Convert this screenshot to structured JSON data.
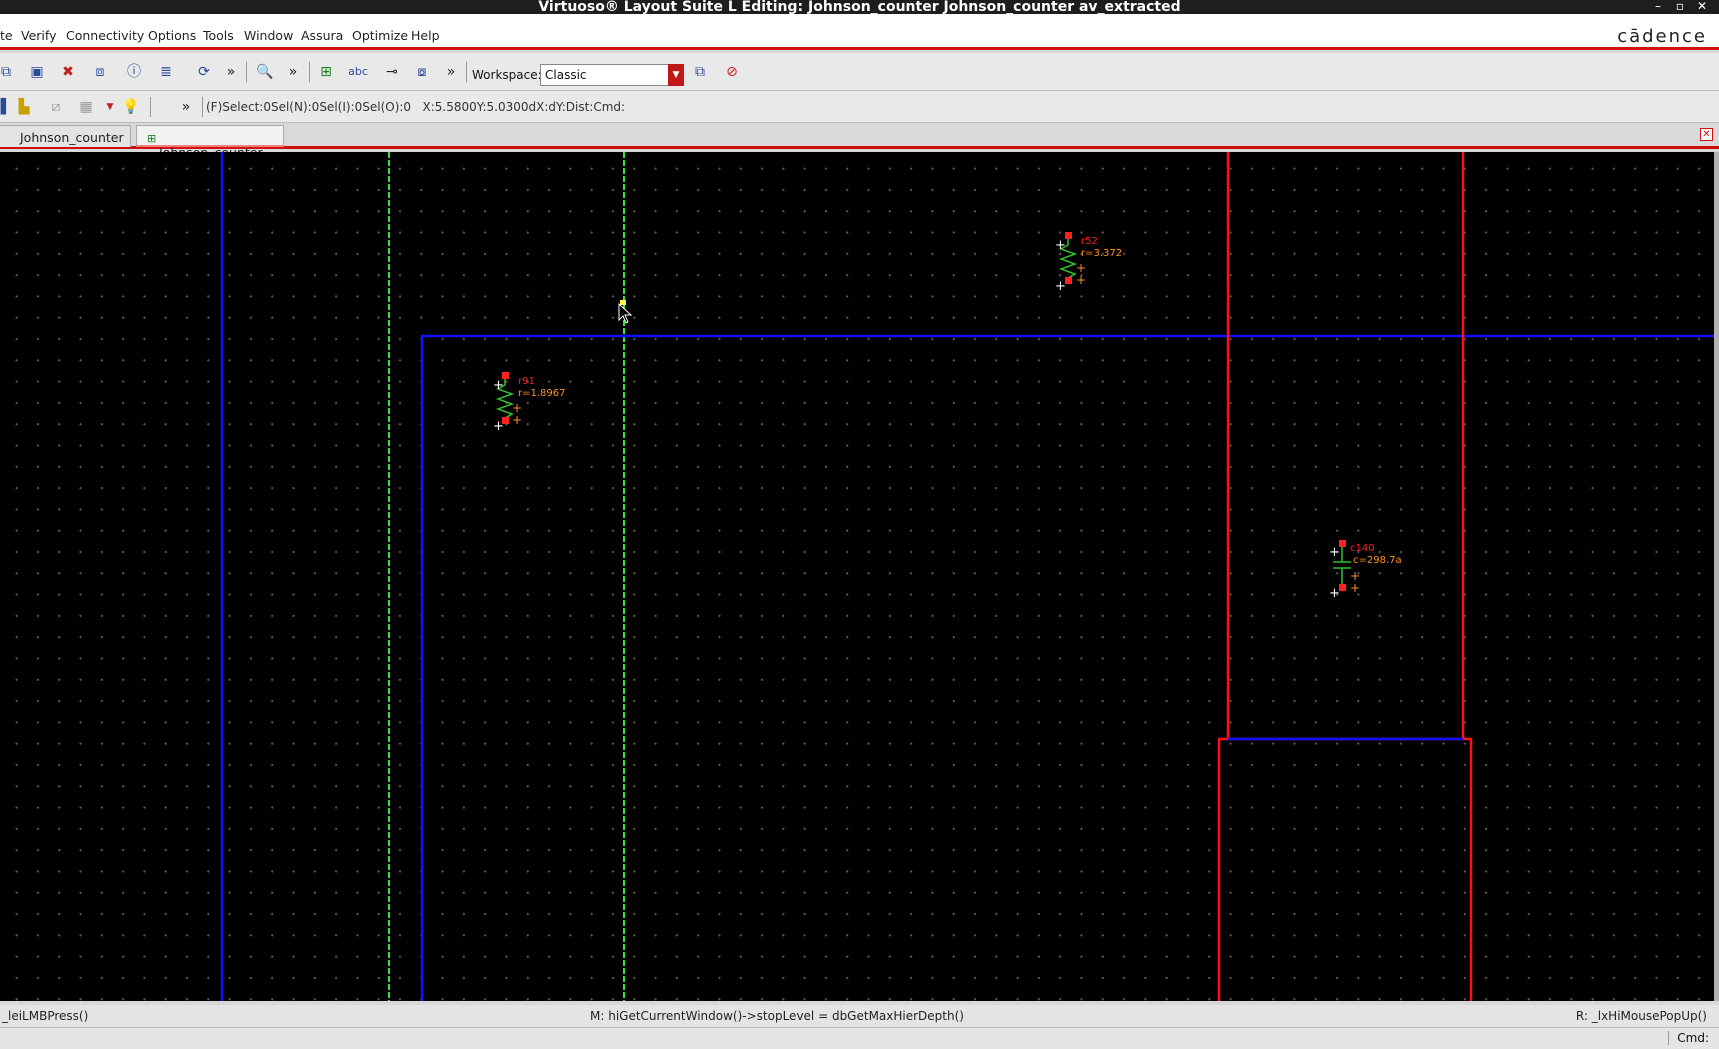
{
  "window": {
    "title": "Virtuoso® Layout Suite L Editing: Johnson_counter Johnson_counter av_extracted",
    "minimize": "–",
    "maximize": "▫",
    "close": "✕"
  },
  "menu": {
    "items": [
      "te",
      "Verify",
      "Connectivity",
      "Options",
      "Tools",
      "Window",
      "Assura",
      "Optimize",
      "Help"
    ],
    "brand": "cādence"
  },
  "toolbar": {
    "workspace_label": "Workspace:",
    "workspace_value": "Classic",
    "more": "»"
  },
  "status": {
    "text": "(F)Select:0Sel(N):0Sel(I):0Sel(O):0   X:5.5800Y:5.0300dX:dY:Dist:Cmd:"
  },
  "tabs": [
    {
      "label": "Johnson_counter",
      "active": false
    },
    {
      "label": "Johnson_counter",
      "active": true
    }
  ],
  "canvas": {
    "devices": [
      {
        "name": "r91",
        "value": "r=1.8967",
        "type": "resistor"
      },
      {
        "name": "r52",
        "value": "r=3.372",
        "type": "resistor"
      },
      {
        "name": "c140",
        "value": "c=298.7a",
        "type": "capacitor"
      }
    ],
    "colors": {
      "blue_wire": "#1010ff",
      "green_wire": "#40e040",
      "red_wire": "#ff1010",
      "label_name": "#ff2020",
      "label_value": "#ff9020"
    }
  },
  "mouse": {
    "left": "_leiLMBPress()",
    "middle": "M: hiGetCurrentWindow()->stopLevel = dbGetMaxHierDepth()",
    "right": "R: _lxHiMousePopUp()"
  },
  "bottom": {
    "cmd": "Cmd:"
  }
}
